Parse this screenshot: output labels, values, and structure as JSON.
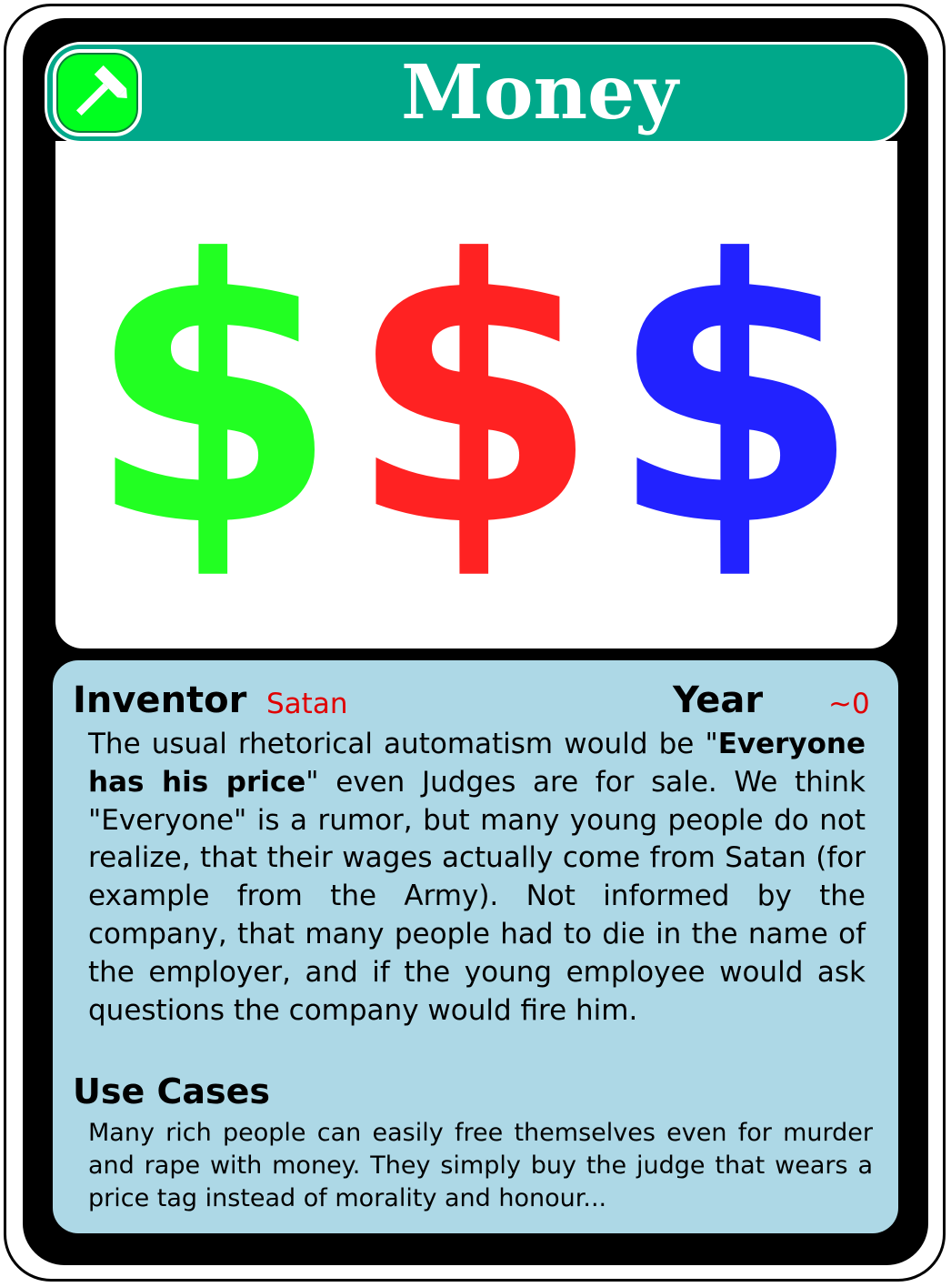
{
  "card": {
    "title": "Money",
    "icon": "hammer-icon",
    "colors": {
      "title_bar": "#00a88a",
      "icon_badge": "#00ff1f",
      "info_panel": "#add8e6",
      "accent_text": "#e00000"
    }
  },
  "image": {
    "symbols": [
      {
        "glyph": "$",
        "color": "#22ff22"
      },
      {
        "glyph": "$",
        "color": "#ff2222"
      },
      {
        "glyph": "$",
        "color": "#2222ff"
      }
    ]
  },
  "inventor": {
    "label": "Inventor",
    "value": "Satan"
  },
  "year": {
    "label": "Year",
    "value": "~0"
  },
  "description": {
    "before_bold": "The usual rhetorical automatism would be \"",
    "bold": "Everyone has his price",
    "after_bold": "\" even Judges are for sale. We think \"Everyone\" is a rumor, but many young people do not realize, that their wages actually come from Satan (for example from the Army). Not informed by the company, that many people had to die in the name of the employer, and if the young employee would ask questions the company would fire him."
  },
  "use_cases": {
    "label": "Use Cases",
    "text": "Many rich people can easily free themselves even for murder and rape with money. They simply buy the judge that wears a price tag instead of morality and honour..."
  }
}
